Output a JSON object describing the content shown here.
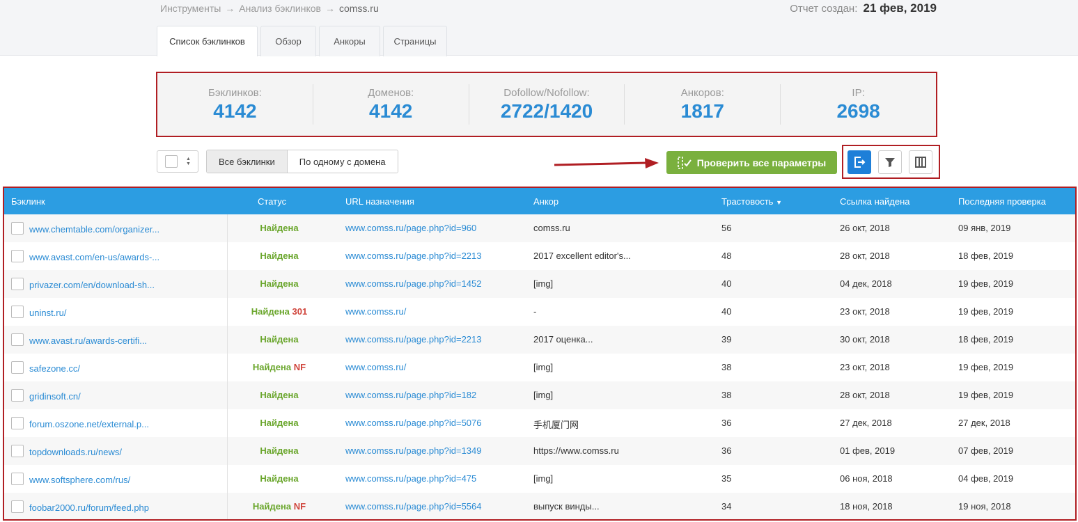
{
  "breadcrumb": {
    "item1": "Инструменты",
    "item2": "Анализ бэклинков",
    "item3": "comss.ru",
    "separator": "→"
  },
  "report": {
    "label": "Отчет создан:",
    "date": "21 фев, 2019"
  },
  "tabs": [
    {
      "label": "Список бэклинков",
      "active": true
    },
    {
      "label": "Обзор"
    },
    {
      "label": "Анкоры"
    },
    {
      "label": "Страницы"
    }
  ],
  "stats": [
    {
      "label": "Бэклинков:",
      "value": "4142"
    },
    {
      "label": "Доменов:",
      "value": "4142"
    },
    {
      "label": "Dofollow/Nofollow:",
      "value": "2722/1420"
    },
    {
      "label": "Анкоров:",
      "value": "1817"
    },
    {
      "label": "IP:",
      "value": "2698"
    }
  ],
  "filters": {
    "all": "Все бэклинки",
    "one_per_domain": "По одному с домена"
  },
  "check_button": "Проверить все параметры",
  "icons": {
    "export": "export-icon",
    "filter": "filter-icon",
    "columns": "columns-icon"
  },
  "colors": {
    "accent": "#2a8bd4",
    "header_bg": "#2c9de2",
    "green": "#7ab03e",
    "highlight": "#b01e23"
  },
  "table": {
    "headers": {
      "backlink": "Бэклинк",
      "status": "Статус",
      "target": "URL назначения",
      "anchor": "Анкор",
      "trust": "Трастовость",
      "trust_sort": "▼",
      "found": "Ссылка найдена",
      "last_check": "Последняя проверка"
    },
    "rows": [
      {
        "backlink": "www.chemtable.com/organizer...",
        "status": "Найдена",
        "status_extra": "",
        "target": "www.comss.ru/page.php?id=960",
        "anchor": "comss.ru",
        "trust": "56",
        "found": "26 окт, 2018",
        "last_check": "09 янв, 2019"
      },
      {
        "backlink": "www.avast.com/en-us/awards-...",
        "status": "Найдена",
        "status_extra": "",
        "target": "www.comss.ru/page.php?id=2213",
        "anchor": "2017 excellent editor's...",
        "trust": "48",
        "found": "28 окт, 2018",
        "last_check": "18 фев, 2019"
      },
      {
        "backlink": "privazer.com/en/download-sh...",
        "status": "Найдена",
        "status_extra": "",
        "target": "www.comss.ru/page.php?id=1452",
        "anchor": "[img]",
        "trust": "40",
        "found": "04 дек, 2018",
        "last_check": "19 фев, 2019"
      },
      {
        "backlink": "uninst.ru/",
        "status": "Найдена",
        "status_extra": "301",
        "target": "www.comss.ru/",
        "anchor": "-",
        "trust": "40",
        "found": "23 окт, 2018",
        "last_check": "19 фев, 2019"
      },
      {
        "backlink": "www.avast.ru/awards-certifi...",
        "status": "Найдена",
        "status_extra": "",
        "target": "www.comss.ru/page.php?id=2213",
        "anchor": "2017 оценка...",
        "trust": "39",
        "found": "30 окт, 2018",
        "last_check": "18 фев, 2019"
      },
      {
        "backlink": "safezone.cc/",
        "status": "Найдена",
        "status_extra": "NF",
        "target": "www.comss.ru/",
        "anchor": "[img]",
        "trust": "38",
        "found": "23 окт, 2018",
        "last_check": "19 фев, 2019"
      },
      {
        "backlink": "gridinsoft.cn/",
        "status": "Найдена",
        "status_extra": "",
        "target": "www.comss.ru/page.php?id=182",
        "anchor": "[img]",
        "trust": "38",
        "found": "28 окт, 2018",
        "last_check": "19 фев, 2019"
      },
      {
        "backlink": "forum.oszone.net/external.p...",
        "status": "Найдена",
        "status_extra": "",
        "target": "www.comss.ru/page.php?id=5076",
        "anchor": "手机厦门网",
        "trust": "36",
        "found": "27 дек, 2018",
        "last_check": "27 дек, 2018"
      },
      {
        "backlink": "topdownloads.ru/news/",
        "status": "Найдена",
        "status_extra": "",
        "target": "www.comss.ru/page.php?id=1349",
        "anchor": "https://www.comss.ru",
        "trust": "36",
        "found": "01 фев, 2019",
        "last_check": "07 фев, 2019"
      },
      {
        "backlink": "www.softsphere.com/rus/",
        "status": "Найдена",
        "status_extra": "",
        "target": "www.comss.ru/page.php?id=475",
        "anchor": "[img]",
        "trust": "35",
        "found": "06 ноя, 2018",
        "last_check": "04 фев, 2019"
      },
      {
        "backlink": "foobar2000.ru/forum/feed.php",
        "status": "Найдена",
        "status_extra": "NF",
        "target": "www.comss.ru/page.php?id=5564",
        "anchor": "выпуск винды...",
        "trust": "34",
        "found": "18 ноя, 2018",
        "last_check": "19 ноя, 2018"
      }
    ]
  }
}
